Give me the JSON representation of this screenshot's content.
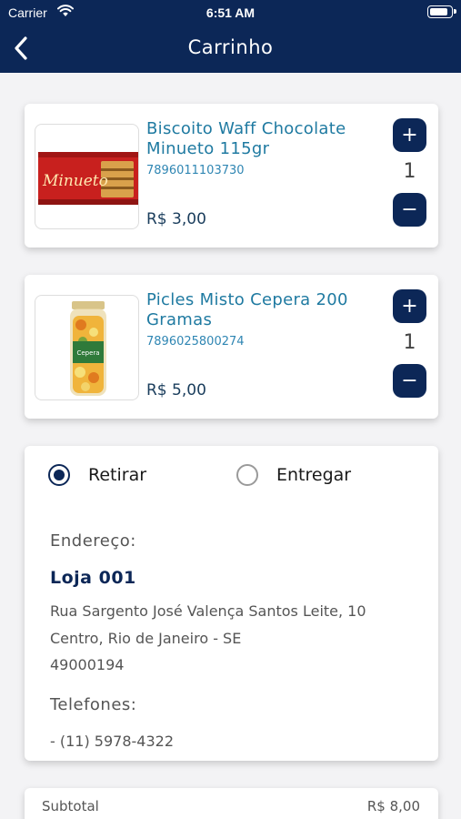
{
  "status_bar": {
    "carrier": "Carrier",
    "time": "6:51 AM",
    "battery_level": 0.9
  },
  "nav": {
    "title": "Carrinho",
    "back_icon": "chevron-left-icon"
  },
  "cart": {
    "items": [
      {
        "name": "Biscoito Waff Chocolate Minueto 115gr",
        "code": "7896011103730",
        "price": "R$ 3,00",
        "quantity": "1",
        "image_brand": "Minueto"
      },
      {
        "name": "Picles Misto Cepera 200 Gramas",
        "code": "7896025800274",
        "price": "R$ 5,00",
        "quantity": "1",
        "image_brand": "Cepera"
      }
    ]
  },
  "delivery": {
    "options": [
      {
        "label": "Retirar",
        "selected": true
      },
      {
        "label": "Entregar",
        "selected": false
      }
    ],
    "address_heading": "Endereço:",
    "store_name": "Loja 001",
    "address_lines": [
      "Rua Sargento José Valença Santos Leite, 10",
      "Centro, Rio de Janeiro - SE",
      "49000194"
    ],
    "phones_heading": "Telefones:",
    "phone": "- (11) 5978-4322"
  },
  "summary": {
    "subtotal_label": "Subtotal",
    "subtotal_value": "R$ 8,00"
  },
  "colors": {
    "primary": "#0c2757",
    "product_name": "#1f7aa1",
    "background": "#f3f3f5"
  }
}
